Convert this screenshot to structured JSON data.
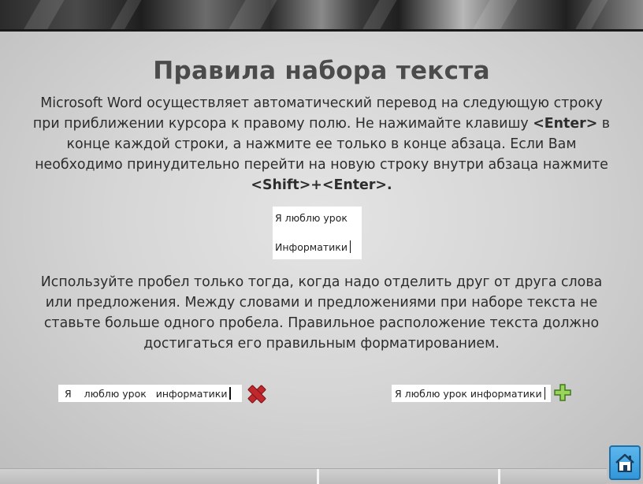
{
  "slide": {
    "title": "Правила набора текста",
    "paragraph1": {
      "part1": "Microsoft Word осуществляет автоматический перевод на следующую строку при приближении курсора к правому полю. Не нажимайте клавишу ",
      "key1": "<Enter>",
      "part2": " в конце каждой строки, а нажмите ее только в конце абзаца. Если Вам необходимо принудительно перейти на новую строку внутри абзаца нажмите ",
      "key2": "<Shift>+<Enter>."
    },
    "example": {
      "line1": "Я люблю урок",
      "line2": "Информатики"
    },
    "paragraph2": "Используйте пробел только тогда, когда надо отделить друг от друга слова или предложения. Между словами и предложениями при наборе текста не ставьте больше одного пробела. Правильное расположение текста должно достигаться его правильным форматированием.",
    "bad_example": "Я    люблю урок   информатики",
    "good_example": "Я люблю урок информатики",
    "icons": {
      "wrong": "cross-icon",
      "right": "plus-icon",
      "home": "home-icon"
    },
    "colors": {
      "title": "#4b4b4b",
      "wrong_mark": "#c0282d",
      "right_mark": "#7cc242",
      "home_button": "#2f95d8"
    }
  }
}
